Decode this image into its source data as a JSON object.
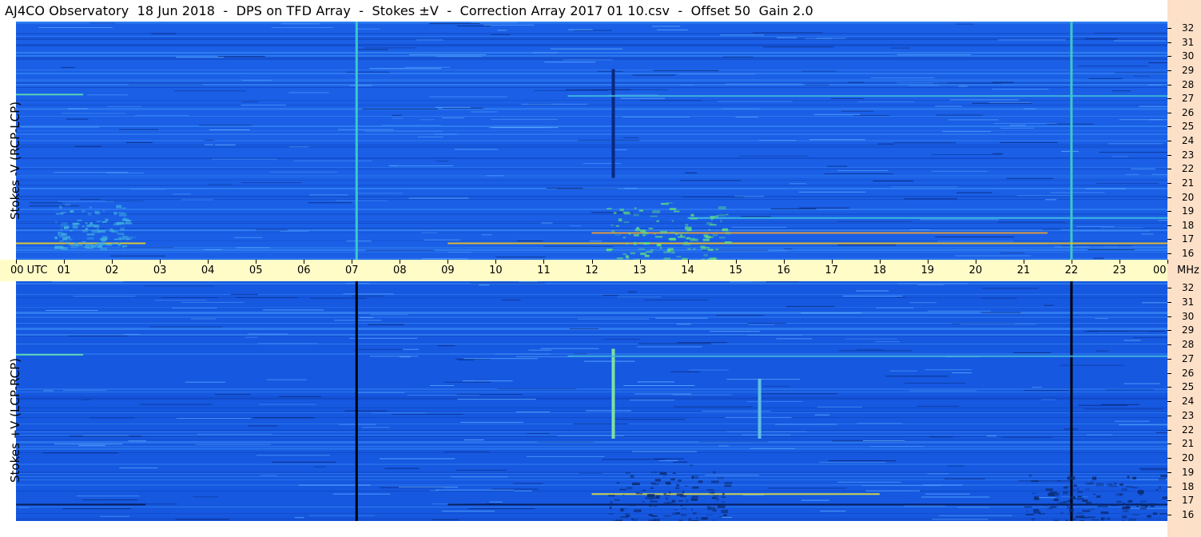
{
  "title": "AJ4CO Observatory  18 Jun 2018  -  DPS on TFD Array  -  Stokes ±V  -  Correction Array 2017 01 10.csv  -  Offset 50  Gain 2.0",
  "chart_data": [
    {
      "type": "heatmap",
      "name": "Stokes -V (RCP-LCP)",
      "ylabel": "Stokes -V  (RCP-LCP)",
      "x_unit": "UTC",
      "y_unit": "MHz",
      "xlim": [
        0,
        24
      ],
      "ylim": [
        16,
        32
      ],
      "background_color": "#1a5fe6",
      "features": [
        {
          "kind": "vertical_line",
          "utc": 7.1,
          "color": "#3cc8c8"
        },
        {
          "kind": "vertical_line",
          "utc": 22.0,
          "color": "#3cc8c8"
        },
        {
          "kind": "vertical_line",
          "utc": 12.45,
          "mhz_range": [
            21.5,
            28.8
          ],
          "color": "#0a2a80"
        },
        {
          "kind": "band",
          "mhz": 17.1,
          "utc_range": [
            0,
            2.7
          ],
          "color": "#f0d020"
        },
        {
          "kind": "band",
          "mhz": 17.1,
          "utc_range": [
            9.0,
            24
          ],
          "color": "#f0c020"
        },
        {
          "kind": "band",
          "mhz": 17.8,
          "utc_range": [
            12.0,
            21.5
          ],
          "color": "#f0a030"
        },
        {
          "kind": "band",
          "mhz": 27.1,
          "utc_range": [
            0,
            1.4
          ],
          "color": "#60e0b0"
        },
        {
          "kind": "band",
          "mhz": 27.0,
          "utc_range": [
            11.5,
            24
          ],
          "color": "#40b8e0"
        },
        {
          "kind": "band",
          "mhz": 18.8,
          "utc_range": [
            14.0,
            24
          ],
          "color": "#40c0e0"
        },
        {
          "kind": "blob",
          "utc_range": [
            12.3,
            14.8
          ],
          "mhz_range": [
            16,
            20
          ],
          "color": "#60e080"
        },
        {
          "kind": "blob",
          "utc_range": [
            0.8,
            2.4
          ],
          "mhz_range": [
            16.8,
            20
          ],
          "color": "#40b0e0"
        }
      ]
    },
    {
      "type": "heatmap",
      "name": "Stokes +V (LCP-RCP)",
      "ylabel": "Stokes +V  (LCP-RCP)",
      "x_unit": "UTC",
      "y_unit": "MHz",
      "xlim": [
        0,
        24
      ],
      "ylim": [
        16,
        32
      ],
      "background_color": "#1658e0",
      "features": [
        {
          "kind": "vertical_line",
          "utc": 7.1,
          "color": "#000000"
        },
        {
          "kind": "vertical_line",
          "utc": 22.0,
          "color": "#000000"
        },
        {
          "kind": "vertical_line",
          "utc": 12.45,
          "mhz_range": [
            21.5,
            27.5
          ],
          "color": "#80e0a0"
        },
        {
          "kind": "vertical_line",
          "utc": 15.5,
          "mhz_range": [
            21.5,
            25.5
          ],
          "color": "#60c0e0"
        },
        {
          "kind": "band",
          "mhz": 17.1,
          "utc_range": [
            0,
            2.7
          ],
          "color": "#051a50"
        },
        {
          "kind": "band",
          "mhz": 17.1,
          "utc_range": [
            9.0,
            24
          ],
          "color": "#051a50"
        },
        {
          "kind": "band",
          "mhz": 17.8,
          "utc_range": [
            12.0,
            18.0
          ],
          "color": "#e0e040"
        },
        {
          "kind": "band",
          "mhz": 27.1,
          "utc_range": [
            0,
            1.4
          ],
          "color": "#60e0b0"
        },
        {
          "kind": "band",
          "mhz": 27.0,
          "utc_range": [
            11.5,
            24
          ],
          "color": "#40b8e0"
        },
        {
          "kind": "blob",
          "utc_range": [
            12.3,
            14.8
          ],
          "mhz_range": [
            16,
            20
          ],
          "color": "#0a2a70"
        },
        {
          "kind": "blob",
          "utc_range": [
            21.0,
            24
          ],
          "mhz_range": [
            16,
            19.5
          ],
          "color": "#0a2a70"
        }
      ]
    }
  ],
  "time_axis": {
    "labels": [
      "00  UTC",
      "01",
      "02",
      "03",
      "04",
      "05",
      "06",
      "07",
      "08",
      "09",
      "10",
      "11",
      "12",
      "13",
      "14",
      "15",
      "16",
      "17",
      "18",
      "19",
      "20",
      "21",
      "22",
      "23",
      "00"
    ],
    "unit": "MHz"
  },
  "freq_axis": {
    "ticks": [
      "32",
      "31",
      "30",
      "29",
      "28",
      "27",
      "26",
      "25",
      "24",
      "23",
      "22",
      "21",
      "20",
      "19",
      "18",
      "17",
      "16"
    ]
  }
}
